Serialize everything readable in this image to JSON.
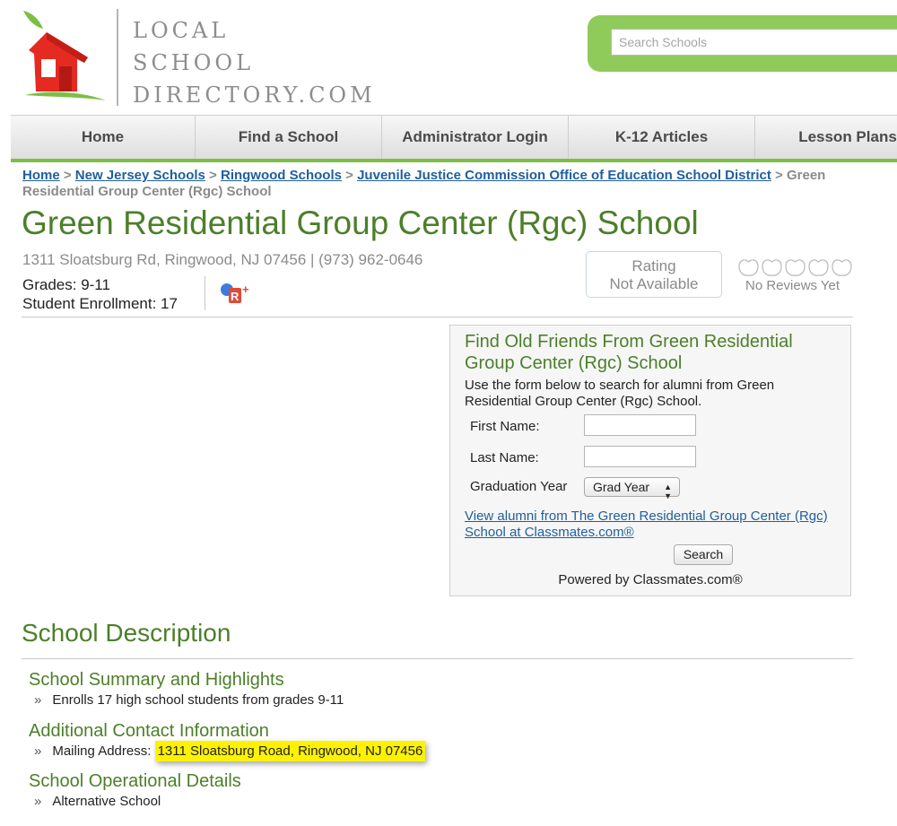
{
  "logo": {
    "line1": "LOCAL",
    "line2": "SCHOOL",
    "line3": "DIRECTORY.COM",
    "icon": "house-apple-logo",
    "red": "#e52a22",
    "green": "#7cbf45"
  },
  "search": {
    "placeholder": "Search Schools"
  },
  "nav": {
    "items": [
      "Home",
      "Find a School",
      "Administrator Login",
      "K-12 Articles",
      "Lesson Plans"
    ]
  },
  "breadcrumb": {
    "links": [
      "Home",
      "New Jersey Schools",
      "Ringwood Schools",
      "Juvenile Justice Commission Office of Education School District"
    ],
    "separator": ">",
    "current": "Green Residential Group Center (Rgc) School"
  },
  "school": {
    "title": "Green Residential Group Center (Rgc) School",
    "address": "1311 Sloatsburg Rd, Ringwood, NJ 07456 | (973) 962-0646",
    "grades": "Grades: 9-11",
    "enrollment": "Student Enrollment: 17",
    "social_icon": "google-plus-icon"
  },
  "rating": {
    "line1": "Rating",
    "line2": "Not Available",
    "reviews": "No Reviews Yet",
    "apple_count": 5
  },
  "friends": {
    "title": "Find Old Friends From Green Residential Group Center (Rgc) School",
    "description": "Use the form below to search for alumni from Green Residential Group Center (Rgc) School.",
    "first_name_label": "First Name:",
    "last_name_label": "Last Name:",
    "grad_year_label": "Graduation Year",
    "grad_year_value": "Grad Year",
    "link": "View alumni from The Green Residential Group Center (Rgc) School at Classmates.com®",
    "button": "Search",
    "powered_by": "Powered by Classmates.com®"
  },
  "description": {
    "title": "School Description",
    "summary_title": "School Summary and Highlights",
    "summary_item": "Enrolls 17 high school students from grades 9-11",
    "contact_title": "Additional Contact Information",
    "contact_label": "Mailing Address: ",
    "contact_value": "1311 Sloatsburg Road, Ringwood, NJ 07456",
    "ops_title": "School Operational Details",
    "ops_item": "Alternative School",
    "bullet": "»"
  }
}
